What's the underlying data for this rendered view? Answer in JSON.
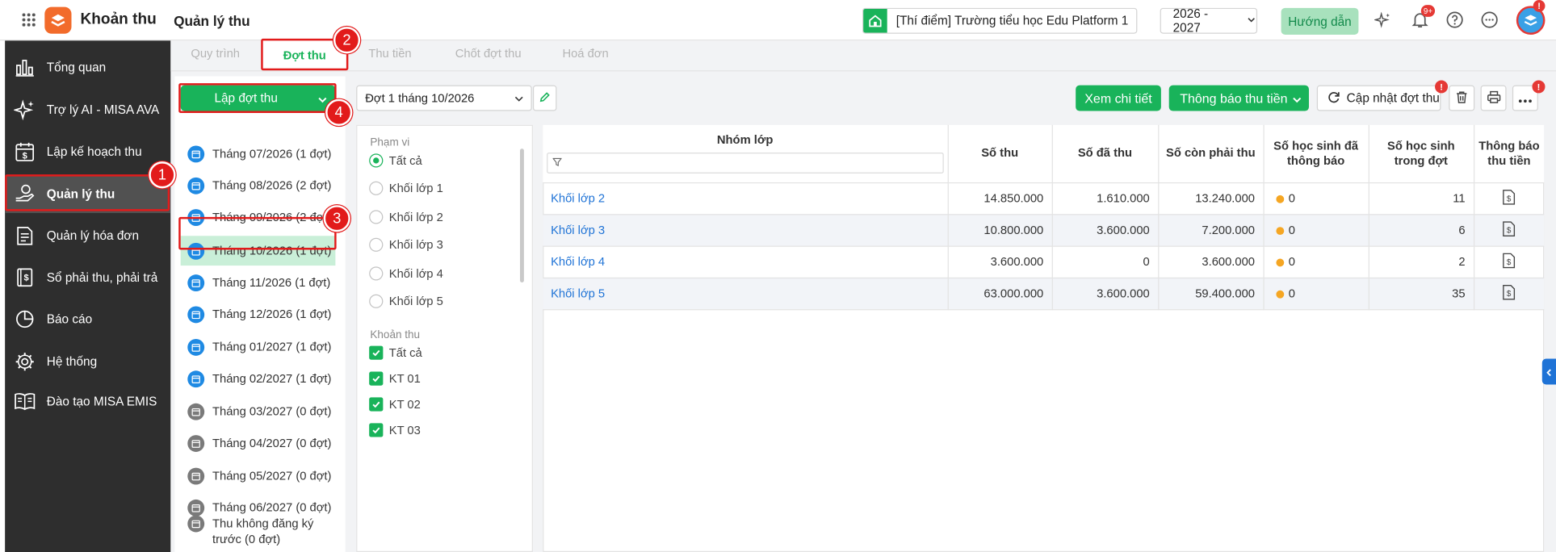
{
  "app": {
    "title": "Khoản thu",
    "page_title": "Quản lý thu"
  },
  "header": {
    "school": "[Thí điểm] Trường tiểu học Edu Platform 1",
    "year": "2026 - 2027",
    "guide_label": "Hướng dẫn",
    "notif_badge": "9+"
  },
  "sidebar": {
    "items": [
      {
        "label": "Tổng quan",
        "icon": "chart-bars-icon"
      },
      {
        "label": "Trợ lý AI - MISA AVA",
        "icon": "sparkle-icon"
      },
      {
        "label": "Lập kế hoạch thu",
        "icon": "calendar-money-icon"
      },
      {
        "label": "Quản lý thu",
        "icon": "hand-coin-icon"
      },
      {
        "label": "Quản lý hóa đơn",
        "icon": "invoice-icon"
      },
      {
        "label": "Sổ phải thu, phải trả",
        "icon": "ledger-icon"
      },
      {
        "label": "Báo cáo",
        "icon": "pie-icon"
      },
      {
        "label": "Hệ thống",
        "icon": "gear-icon"
      },
      {
        "label": "Đào tạo MISA EMIS",
        "icon": "book-icon"
      }
    ]
  },
  "tabs": [
    "Quy trình",
    "Đợt thu",
    "Thu tiền",
    "Chốt đợt thu",
    "Hoá đơn"
  ],
  "create_btn": "Lập đợt thu",
  "months": [
    {
      "label": "Tháng 07/2026 (1 đợt)",
      "active": true
    },
    {
      "label": "Tháng 08/2026 (2 đợt)",
      "active": true
    },
    {
      "label": "Tháng 09/2026 (2 đợt)",
      "active": true
    },
    {
      "label": "Tháng 10/2026 (1 đợt)",
      "active": true
    },
    {
      "label": "Tháng 11/2026 (1 đợt)",
      "active": true
    },
    {
      "label": "Tháng 12/2026 (1 đợt)",
      "active": true
    },
    {
      "label": "Tháng 01/2027 (1 đợt)",
      "active": true
    },
    {
      "label": "Tháng 02/2027 (1 đợt)",
      "active": true
    },
    {
      "label": "Tháng 03/2027 (0 đợt)",
      "active": false
    },
    {
      "label": "Tháng 04/2027 (0 đợt)",
      "active": false
    },
    {
      "label": "Tháng 05/2027 (0 đợt)",
      "active": false
    },
    {
      "label": "Tháng 06/2027 (0 đợt)",
      "active": false
    },
    {
      "label": "Thu không đăng ký trước (0 đợt)",
      "active": false
    }
  ],
  "batch_select": "Đợt 1 tháng 10/2026",
  "filters": {
    "scope_title": "Phạm vi",
    "scope": [
      "Tất cả",
      "Khối lớp 1",
      "Khối lớp 2",
      "Khối lớp 3",
      "Khối lớp 4",
      "Khối lớp 5"
    ],
    "fee_title": "Khoản thu",
    "fees": [
      "Tất cả",
      "KT 01",
      "KT 02",
      "KT 03"
    ]
  },
  "toolbar": {
    "detail": "Xem chi tiết",
    "notify": "Thông báo thu tiền",
    "update": "Cập nhật đợt thu"
  },
  "table": {
    "headers": [
      "Nhóm lớp",
      "Số thu",
      "Số đã thu",
      "Số còn phải thu",
      "Số học sinh đã thông báo",
      "Số học sinh trong đợt",
      "Thông báo thu tiền"
    ],
    "rows": [
      {
        "group": "Khối lớp 2",
        "total": "14.850.000",
        "paid": "1.610.000",
        "remain": "13.240.000",
        "notified": "0",
        "students": "11"
      },
      {
        "group": "Khối lớp 3",
        "total": "10.800.000",
        "paid": "3.600.000",
        "remain": "7.200.000",
        "notified": "0",
        "students": "6"
      },
      {
        "group": "Khối lớp 4",
        "total": "3.600.000",
        "paid": "0",
        "remain": "3.600.000",
        "notified": "0",
        "students": "2"
      },
      {
        "group": "Khối lớp 5",
        "total": "63.000.000",
        "paid": "3.600.000",
        "remain": "59.400.000",
        "notified": "0",
        "students": "35"
      }
    ]
  },
  "callouts": [
    "1",
    "2",
    "3",
    "4"
  ],
  "colors": {
    "accent": "#19b35a",
    "link": "#1f73d6",
    "callout": "#e21b1b",
    "sidebar": "#2e2e2e"
  }
}
